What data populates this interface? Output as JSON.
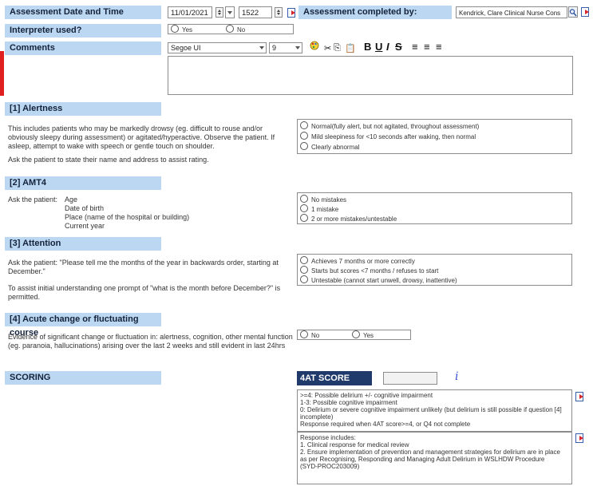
{
  "assessment": {
    "date_label": "Assessment Date and Time",
    "date_value": "11/01/2021",
    "time_value": "1522",
    "completed_by_label": "Assessment completed by:",
    "completed_by_value": "Kendrick, Clare  Clinical Nurse Cons"
  },
  "interpreter": {
    "label": "Interpreter used?",
    "options": [
      "Yes",
      "No"
    ]
  },
  "comments": {
    "label": "Comments",
    "font_value": "Segoe UI",
    "size_value": "9"
  },
  "alertness": {
    "heading": "[1] Alertness",
    "description": "This includes patients who may be markedly drowsy (eg. difficult to rouse and/or obviously sleepy during assessment) or agitated/hyperactive.  Observe the patient.  If asleep, attempt to wake with speech or gentle touch on shoulder.",
    "instruction": "Ask the patient to state their name and address to assist rating.",
    "options": [
      "Normal(fully alert, but not agitated, throughout assessment)",
      "Mild sleepiness for <10 seconds after waking, then normal",
      "Clearly abnormal"
    ]
  },
  "amt4": {
    "heading": "[2] AMT4",
    "prompt": "Ask the patient:",
    "items": [
      "Age",
      "Date of birth",
      "Place (name of the hospital or building)",
      "Current year"
    ],
    "options": [
      "No mistakes",
      "1 mistake",
      "2 or more mistakes/untestable"
    ]
  },
  "attention": {
    "heading": "[3] Attention",
    "description": "Ask the patient: \"Please tell me the months of the year in backwards order, starting at December.\"",
    "instruction": "To assist initial understanding one prompt of \"what is the month before December?\" is permitted.",
    "options": [
      "Achieves 7 months or more correctly",
      "Starts but scores <7 months / refuses to start",
      "Untestable (cannot start unwell, drowsy, inattentive)"
    ]
  },
  "acute": {
    "heading": "[4] Acute change or fluctuating course",
    "description": "Evidence of significant change or fluctuation in: alertness, cognition, other mental function (eg. paranoia, hallucinations) arising over the last 2 weeks and still evident in last 24hrs",
    "options": [
      "No",
      "Yes"
    ]
  },
  "scoring": {
    "label": "SCORING",
    "score_label": "4AT SCORE",
    "score_value": "",
    "info_glyph": "i",
    "interpretation": [
      ">=4: Possible delirium +/- cognitive impairment",
      "1-3: Possible cognitive impairment",
      "0: Delirium or severe cognitive impairment unlikely (but delirium is still possible if question [4] incomplete)",
      "Response required when 4AT score>=4, or Q4 not complete"
    ],
    "response": [
      "Response includes:",
      "1.   Clinical response for medical review",
      "2.   Ensure implementation of prevention and management strategies for delirium are in place as per Recognising, Responding and Managing Adult Delirium in WSLHDW Procedure (SYD-PROC203009)"
    ]
  },
  "colors": {
    "label_bg": "#bcd7f2",
    "score_bg": "#1f3a6b",
    "accent_red": "#d8242a"
  }
}
